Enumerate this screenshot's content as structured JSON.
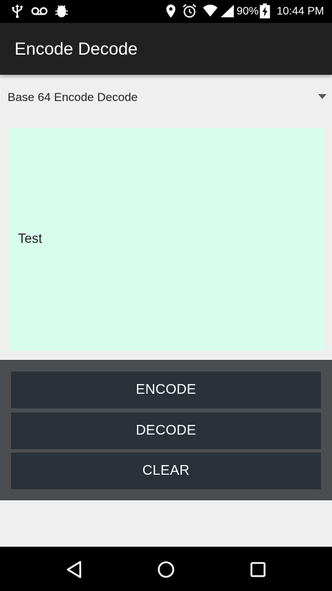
{
  "status_bar": {
    "battery_percent": "90%",
    "time": "10:44 PM",
    "left_icons": [
      "usb-icon",
      "voicemail-icon",
      "android-debug-icon"
    ],
    "right_icons": [
      "location-icon",
      "alarm-icon",
      "wifi-icon",
      "signal-icon",
      "battery-charging-icon"
    ]
  },
  "app_bar": {
    "title": "Encode Decode"
  },
  "spinner": {
    "selected": "Base 64 Encode Decode"
  },
  "text_area": {
    "value": "Test"
  },
  "buttons": {
    "encode": "ENCODE",
    "decode": "DECODE",
    "clear": "CLEAR"
  },
  "nav_bar": {
    "icons": [
      "back-icon",
      "home-icon",
      "recents-icon"
    ]
  },
  "colors": {
    "app_bar": "#212121",
    "text_area_bg": "#d8fdec",
    "button_bg": "#2a3139",
    "button_panel_bg": "#4b4d50",
    "background": "#efefef"
  }
}
